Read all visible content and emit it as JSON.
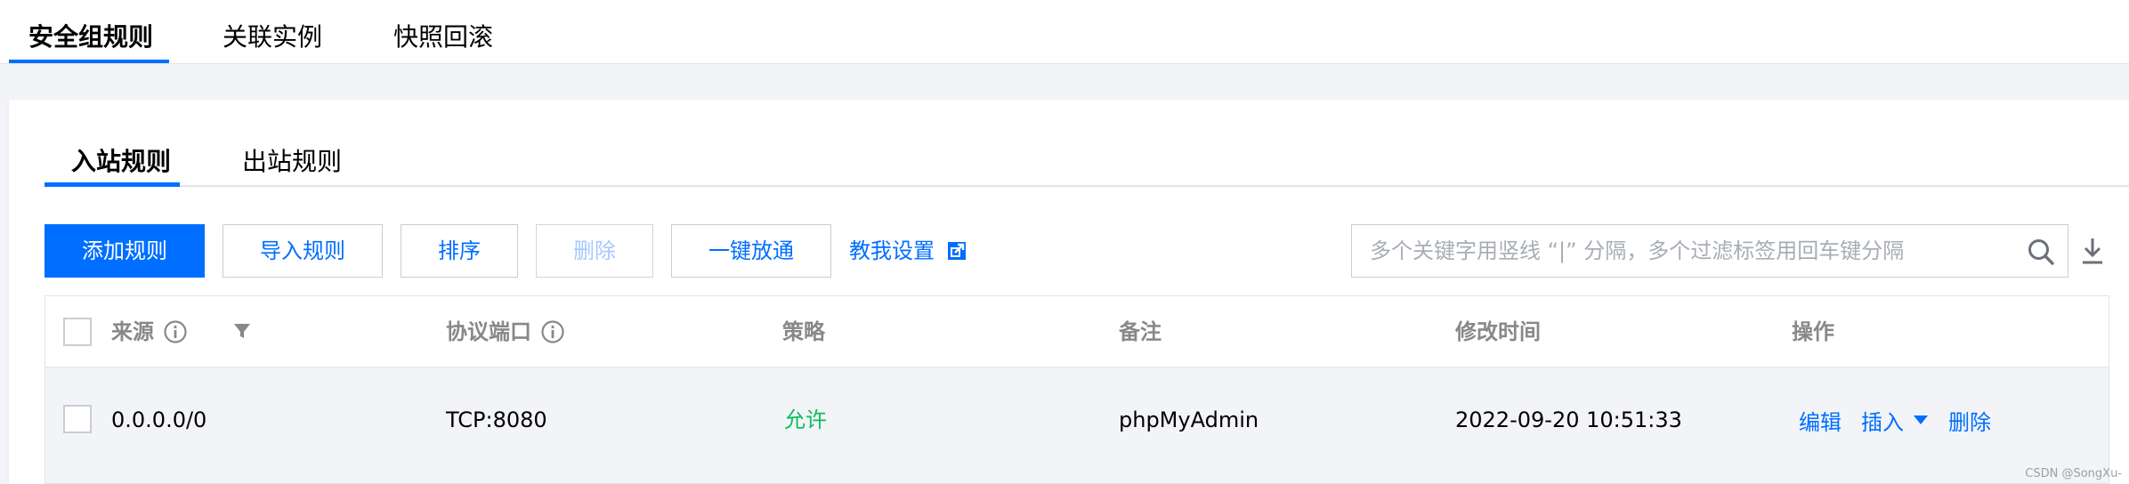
{
  "top_tabs": [
    {
      "label": "安全组规则",
      "active": true
    },
    {
      "label": "关联实例",
      "active": false
    },
    {
      "label": "快照回滚",
      "active": false
    }
  ],
  "sub_tabs": [
    {
      "label": "入站规则",
      "active": true
    },
    {
      "label": "出站规则",
      "active": false
    }
  ],
  "toolbar": {
    "add_label": "添加规则",
    "import_label": "导入规则",
    "sort_label": "排序",
    "delete_label": "删除",
    "allow_all_label": "一键放通",
    "help_label": "教我设置",
    "help_icon": "external-link-icon",
    "download_icon": "download-icon"
  },
  "search": {
    "placeholder": "多个关键字用竖线 “|” 分隔，多个过滤标签用回车键分隔",
    "value": "",
    "icon": "search-icon"
  },
  "table": {
    "columns": [
      "来源",
      "协议端口",
      "策略",
      "备注",
      "修改时间",
      "操作"
    ],
    "rows": [
      {
        "source": "0.0.0.0/0",
        "port": "TCP:8080",
        "policy": "允许",
        "remark": "phpMyAdmin",
        "modified": "2022-09-20 10:51:33",
        "actions": {
          "edit": "编辑",
          "insert": "插入",
          "delete": "删除"
        }
      }
    ]
  },
  "colors": {
    "accent": "#006eff",
    "allow": "#0abf5b",
    "header_text": "#888888",
    "row_bg": "#f3f4f7"
  },
  "watermark": "CSDN @SongXu-"
}
